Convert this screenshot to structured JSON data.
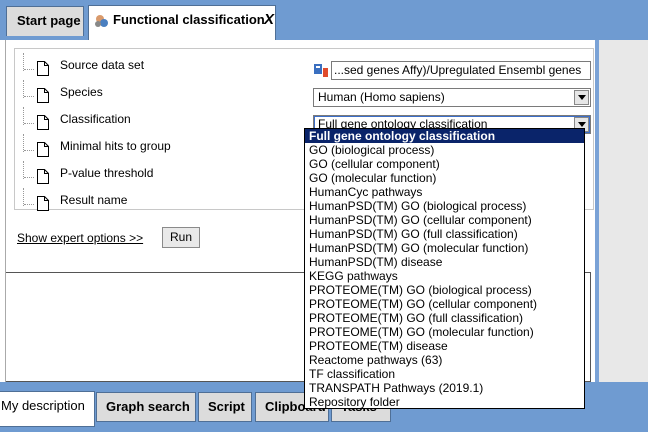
{
  "top_tabs": {
    "start_page": "Start page",
    "functional": "Functional classification",
    "close": "X"
  },
  "form": {
    "rows": [
      {
        "label": "Source data set",
        "value": "...sed genes Affy)/Upregulated Ensembl genes"
      },
      {
        "label": "Species",
        "value": "Human (Homo sapiens)"
      },
      {
        "label": "Classification",
        "value": "Full gene ontology classification"
      },
      {
        "label": "Minimal hits to group",
        "value": ""
      },
      {
        "label": "P-value threshold",
        "value": ""
      },
      {
        "label": "Result name",
        "value": ""
      }
    ],
    "expert_link": "Show expert options >>",
    "run": "Run"
  },
  "dropdown": {
    "options": [
      "Full gene ontology classification",
      "GO (biological process)",
      "GO (cellular component)",
      "GO (molecular function)",
      "HumanCyc pathways",
      "HumanPSD(TM) GO (biological process)",
      "HumanPSD(TM) GO (cellular component)",
      "HumanPSD(TM) GO (full classification)",
      "HumanPSD(TM) GO (molecular function)",
      "HumanPSD(TM) disease",
      "KEGG pathways",
      "PROTEOME(TM) GO (biological process)",
      "PROTEOME(TM) GO (cellular component)",
      "PROTEOME(TM) GO (full classification)",
      "PROTEOME(TM) GO (molecular function)",
      "PROTEOME(TM) disease",
      "Reactome pathways (63)",
      "TF classification",
      "TRANSPATH Pathways (2019.1)",
      "Repository folder"
    ],
    "selected_index": 0
  },
  "bottom_tabs": {
    "description": "My description",
    "graph_search": "Graph search",
    "script": "Script",
    "clipboard": "Clipboard",
    "tasks": "Tasks"
  },
  "colors": {
    "tab_bar": "#6f9bd1",
    "selected_option": "#0a246a"
  },
  "icons": {
    "doc": "document-icon",
    "source": "dataset-icon",
    "functional": "functional-classification-icon"
  }
}
